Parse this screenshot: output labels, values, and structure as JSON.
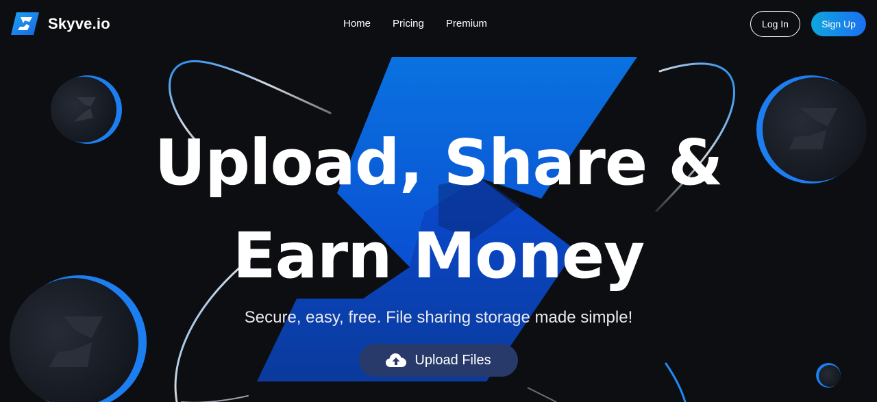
{
  "brand": {
    "name": "Skyve.io",
    "logo_icon": "skyve-s-logo-icon",
    "accent_color": "#1b8cf5"
  },
  "nav": {
    "items": [
      {
        "label": "Home"
      },
      {
        "label": "Pricing"
      },
      {
        "label": "Premium"
      }
    ]
  },
  "auth": {
    "login_label": "Log In",
    "signup_label": "Sign Up"
  },
  "hero": {
    "headline_line1": "Upload, Share &",
    "headline_line2": "Earn Money",
    "subtitle": "Secure, easy, free. File sharing storage made simple!",
    "cta_label": "Upload Files",
    "cta_icon": "cloud-upload-icon"
  },
  "colors": {
    "background": "#0d0e11",
    "cta_background": "#273a6a",
    "signup_gradient_start": "#0fa6de",
    "signup_gradient_end": "#1c6ff0"
  }
}
